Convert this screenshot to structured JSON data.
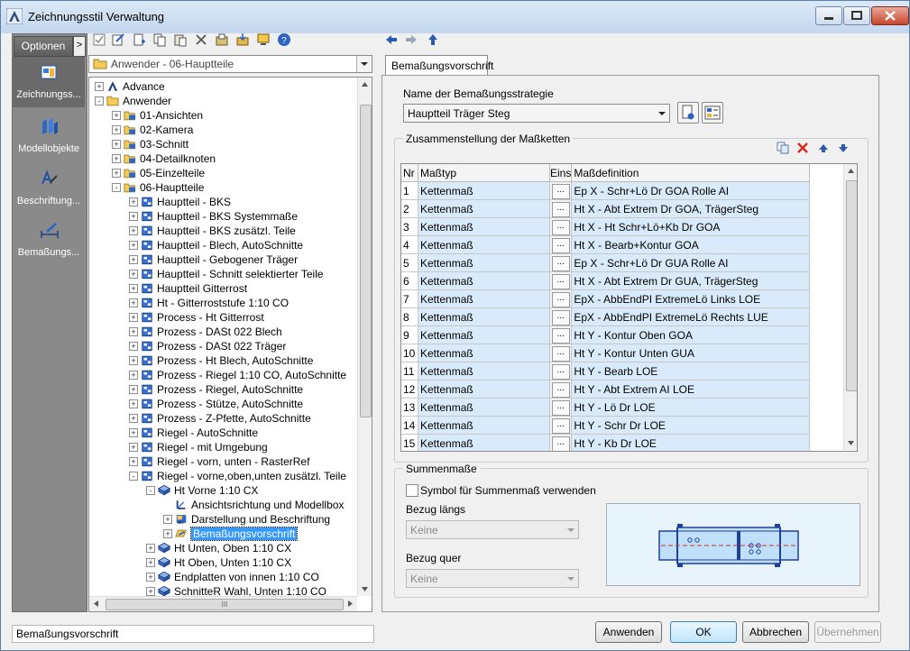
{
  "window": {
    "title": "Zeichnungsstil Verwaltung"
  },
  "left_nav": {
    "options_label": "Optionen",
    "options_arrow": ">",
    "items": [
      {
        "label": "Zeichnungss...",
        "icon": "drawing-style-icon",
        "selected": true
      },
      {
        "label": "Modellobjekte",
        "icon": "model-objects-icon",
        "selected": false
      },
      {
        "label": "Beschriftung...",
        "icon": "labeling-icon",
        "selected": false
      },
      {
        "label": "Bemaßungs...",
        "icon": "dimension-icon",
        "selected": false
      }
    ]
  },
  "tree": {
    "combo_text": "Anwender - 06-Hauptteile",
    "scroll_h_grip": "III",
    "nodes": [
      {
        "label": "Advance",
        "depth": 1,
        "icon": "advance-icon",
        "expander": "+"
      },
      {
        "label": "Anwender",
        "depth": 1,
        "icon": "folder-icon",
        "expander": "-"
      },
      {
        "label": "01-Ansichten",
        "depth": 2,
        "icon": "style-group-icon",
        "expander": "+"
      },
      {
        "label": "02-Kamera",
        "depth": 2,
        "icon": "style-group-icon",
        "expander": "+"
      },
      {
        "label": "03-Schnitt",
        "depth": 2,
        "icon": "style-group-icon",
        "expander": "+"
      },
      {
        "label": "04-Detailknoten",
        "depth": 2,
        "icon": "style-group-icon",
        "expander": "+"
      },
      {
        "label": "05-Einzelteile",
        "depth": 2,
        "icon": "style-group-icon",
        "expander": "+"
      },
      {
        "label": "06-Hauptteile",
        "depth": 2,
        "icon": "style-group-icon",
        "expander": "-"
      },
      {
        "label": "Hauptteil - BKS",
        "depth": 3,
        "icon": "style-icon",
        "expander": "+"
      },
      {
        "label": "Hauptteil - BKS Systemmaße",
        "depth": 3,
        "icon": "style-icon",
        "expander": "+"
      },
      {
        "label": "Hauptteil - BKS zusätzl. Teile",
        "depth": 3,
        "icon": "style-icon",
        "expander": "+"
      },
      {
        "label": "Hauptteil - Blech, AutoSchnitte",
        "depth": 3,
        "icon": "style-icon",
        "expander": "+"
      },
      {
        "label": "Hauptteil - Gebogener Träger",
        "depth": 3,
        "icon": "style-icon",
        "expander": "+"
      },
      {
        "label": "Hauptteil - Schnitt selektierter Teile",
        "depth": 3,
        "icon": "style-icon",
        "expander": "+"
      },
      {
        "label": "Hauptteil Gitterrost",
        "depth": 3,
        "icon": "style-icon",
        "expander": "+"
      },
      {
        "label": "Ht - Gitterroststufe 1:10 CO",
        "depth": 3,
        "icon": "style-icon",
        "expander": "+"
      },
      {
        "label": "Process - Ht Gitterrost",
        "depth": 3,
        "icon": "style-icon",
        "expander": "+"
      },
      {
        "label": "Prozess - DASt 022 Blech",
        "depth": 3,
        "icon": "style-icon",
        "expander": "+"
      },
      {
        "label": "Prozess - DASt 022 Träger",
        "depth": 3,
        "icon": "style-icon",
        "expander": "+"
      },
      {
        "label": "Prozess - Ht Blech, AutoSchnitte",
        "depth": 3,
        "icon": "style-icon",
        "expander": "+"
      },
      {
        "label": "Prozess - Riegel 1:10 CO, AutoSchnitte",
        "depth": 3,
        "icon": "style-icon",
        "expander": "+"
      },
      {
        "label": "Prozess - Riegel, AutoSchnitte",
        "depth": 3,
        "icon": "style-icon",
        "expander": "+"
      },
      {
        "label": "Prozess - Stütze, AutoSchnitte",
        "depth": 3,
        "icon": "style-icon",
        "expander": "+"
      },
      {
        "label": "Prozess - Z-Pfette, AutoSchnitte",
        "depth": 3,
        "icon": "style-icon",
        "expander": "+"
      },
      {
        "label": "Riegel - AutoSchnitte",
        "depth": 3,
        "icon": "style-icon",
        "expander": "+"
      },
      {
        "label": "Riegel - mit Umgebung",
        "depth": 3,
        "icon": "style-icon",
        "expander": "+"
      },
      {
        "label": "Riegel - vorn, unten - RasterRef",
        "depth": 3,
        "icon": "style-icon",
        "expander": "+"
      },
      {
        "label": "Riegel - vorne,oben,unten zusätzl. Teile",
        "depth": 3,
        "icon": "style-icon",
        "expander": "-"
      },
      {
        "label": "Ht Vorne 1:10 CX",
        "depth": 4,
        "icon": "view-icon",
        "expander": "-"
      },
      {
        "label": "Ansichtsrichtung und Modellbox",
        "depth": 5,
        "icon": "view-direction-icon",
        "expander": ""
      },
      {
        "label": "Darstellung und Beschriftung",
        "depth": 5,
        "icon": "display-icon",
        "expander": "+"
      },
      {
        "label": "Bemaßungsvorschrift",
        "depth": 5,
        "icon": "dimension-rule-icon",
        "expander": "+",
        "selected": true
      },
      {
        "label": "Ht Unten, Oben 1:10 CX",
        "depth": 4,
        "icon": "view-icon",
        "expander": "+"
      },
      {
        "label": "Ht Oben, Unten 1:10 CX",
        "depth": 4,
        "icon": "view-icon",
        "expander": "+"
      },
      {
        "label": "Endplatten von innen 1:10 CO",
        "depth": 4,
        "icon": "view-icon",
        "expander": "+"
      },
      {
        "label": "SchnitteR Wahl, Unten 1:10 CO",
        "depth": 4,
        "icon": "view-icon",
        "expander": "+"
      }
    ]
  },
  "tab": {
    "label": "Bemaßungsvorschrift"
  },
  "strategy": {
    "label": "Name der Bemaßungsstrategie",
    "value": "Hauptteil Träger Steg"
  },
  "chains": {
    "group_label": "Zusammenstellung der Maßketten",
    "columns": [
      "Nr",
      "Maßtyp",
      "Eins",
      "Maßdefinition"
    ],
    "dot_label": "...",
    "rows": [
      {
        "nr": "1",
        "typ": "Kettenmaß",
        "def": "Ep X - Schr+Lö Dr GOA Rolle AI"
      },
      {
        "nr": "2",
        "typ": "Kettenmaß",
        "def": "Ht X - Abt Extrem Dr GOA, TrägerSteg"
      },
      {
        "nr": "3",
        "typ": "Kettenmaß",
        "def": "Ht X - Ht Schr+Lö+Kb Dr GOA"
      },
      {
        "nr": "4",
        "typ": "Kettenmaß",
        "def": "Ht X - Bearb+Kontur GOA"
      },
      {
        "nr": "5",
        "typ": "Kettenmaß",
        "def": "Ep X - Schr+Lö Dr GUA Rolle AI"
      },
      {
        "nr": "6",
        "typ": "Kettenmaß",
        "def": "Ht X - Abt Extrem Dr GUA, TrägerSteg"
      },
      {
        "nr": "7",
        "typ": "Kettenmaß",
        "def": "EpX - AbbEndPI ExtremeLö Links LOE"
      },
      {
        "nr": "8",
        "typ": "Kettenmaß",
        "def": "EpX - AbbEndPI ExtremeLö Rechts LUE"
      },
      {
        "nr": "9",
        "typ": "Kettenmaß",
        "def": "Ht Y - Kontur Oben GOA"
      },
      {
        "nr": "10",
        "typ": "Kettenmaß",
        "def": "Ht Y - Kontur Unten GUA"
      },
      {
        "nr": "11",
        "typ": "Kettenmaß",
        "def": "Ht Y - Bearb LOE"
      },
      {
        "nr": "12",
        "typ": "Kettenmaß",
        "def": "Ht Y - Abt Extrem AI LOE"
      },
      {
        "nr": "13",
        "typ": "Kettenmaß",
        "def": "Ht Y - Lö Dr LOE"
      },
      {
        "nr": "14",
        "typ": "Kettenmaß",
        "def": "Ht Y - Schr Dr LOE"
      },
      {
        "nr": "15",
        "typ": "Kettenmaß",
        "def": "Ht Y - Kb Dr LOE"
      }
    ]
  },
  "sums": {
    "group_label": "Summenmaße",
    "checkbox_label": "Symbol für Summenmaß verwenden",
    "checked": false,
    "long_label": "Bezug längs",
    "long_value": "Keine",
    "cross_label": "Bezug quer",
    "cross_value": "Keine"
  },
  "footer": {
    "status": "Bemaßungsvorschrift",
    "apply_label": "Anwenden",
    "ok_label": "OK",
    "cancel_label": "Abbrechen",
    "take_label": "Übernehmen"
  },
  "colors": {
    "selection": "#3399ff",
    "cell_blue": "#d9ebfa",
    "nav_bg": "#8a8a8a"
  }
}
